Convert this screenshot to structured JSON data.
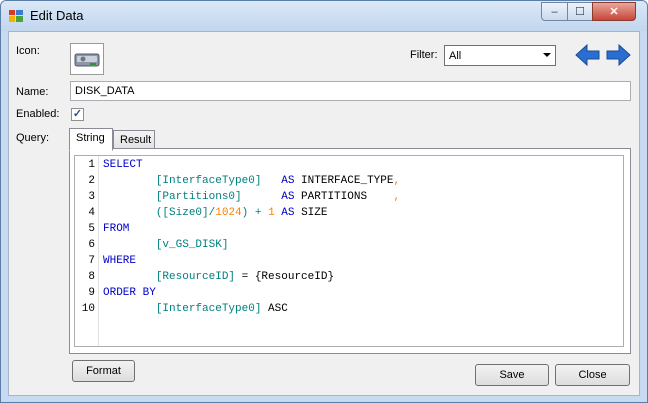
{
  "window": {
    "title": "Edit Data"
  },
  "title_controls": {
    "minimize": "‒",
    "maximize": "☐",
    "close": "✕"
  },
  "labels": {
    "icon": "Icon:",
    "filter": "Filter:",
    "name": "Name:",
    "enabled": "Enabled:",
    "query": "Query:"
  },
  "filter": {
    "selected": "All"
  },
  "name_field": {
    "value": "DISK_DATA"
  },
  "enabled": {
    "checked": true,
    "mark": "✓"
  },
  "tabs": [
    {
      "label": "String",
      "active": true
    },
    {
      "label": "Result",
      "active": false
    }
  ],
  "query_lines": [
    {
      "n": "1",
      "tokens": [
        {
          "t": "SELECT",
          "c": "kw"
        }
      ]
    },
    {
      "n": "2",
      "tokens": [
        {
          "t": "        ",
          "c": "sym"
        },
        {
          "t": "[InterfaceType0]",
          "c": "id"
        },
        {
          "t": "   ",
          "c": "sym"
        },
        {
          "t": "AS",
          "c": "kw"
        },
        {
          "t": " INTERFACE_TYPE",
          "c": "sym"
        },
        {
          "t": ",",
          "c": "cmm"
        }
      ]
    },
    {
      "n": "3",
      "tokens": [
        {
          "t": "        ",
          "c": "sym"
        },
        {
          "t": "[Partitions0]",
          "c": "id"
        },
        {
          "t": "      ",
          "c": "sym"
        },
        {
          "t": "AS",
          "c": "kw"
        },
        {
          "t": " PARTITIONS    ",
          "c": "sym"
        },
        {
          "t": ",",
          "c": "cmm"
        }
      ]
    },
    {
      "n": "4",
      "tokens": [
        {
          "t": "        ",
          "c": "sym"
        },
        {
          "t": "(",
          "c": "id"
        },
        {
          "t": "[Size0]",
          "c": "id"
        },
        {
          "t": "/",
          "c": "id"
        },
        {
          "t": "1024",
          "c": "num"
        },
        {
          "t": ") + ",
          "c": "id"
        },
        {
          "t": "1",
          "c": "num"
        },
        {
          "t": " ",
          "c": "sym"
        },
        {
          "t": "AS",
          "c": "kw"
        },
        {
          "t": " SIZE",
          "c": "sym"
        }
      ]
    },
    {
      "n": "5",
      "tokens": [
        {
          "t": "FROM",
          "c": "kw"
        }
      ]
    },
    {
      "n": "6",
      "tokens": [
        {
          "t": "        ",
          "c": "sym"
        },
        {
          "t": "[v_GS_DISK]",
          "c": "id"
        }
      ]
    },
    {
      "n": "7",
      "tokens": [
        {
          "t": "WHERE",
          "c": "kw"
        }
      ]
    },
    {
      "n": "8",
      "tokens": [
        {
          "t": "        ",
          "c": "sym"
        },
        {
          "t": "[ResourceID]",
          "c": "id"
        },
        {
          "t": " = {ResourceID}",
          "c": "sym"
        }
      ]
    },
    {
      "n": "9",
      "tokens": [
        {
          "t": "ORDER BY",
          "c": "kw"
        }
      ]
    },
    {
      "n": "10",
      "tokens": [
        {
          "t": "        ",
          "c": "sym"
        },
        {
          "t": "[InterfaceType0]",
          "c": "id"
        },
        {
          "t": " ASC",
          "c": "sym"
        }
      ]
    }
  ],
  "buttons": {
    "format": "Format",
    "save": "Save",
    "close": "Close"
  },
  "colors": {
    "keyword": "#0000cc",
    "identifier": "#008080",
    "number": "#ff8000",
    "arrow": "#2a6fd0"
  },
  "icons": {
    "app": "edit-data-app-icon",
    "disk": "hard-disk-icon",
    "back": "arrow-left-icon",
    "forward": "arrow-right-icon"
  }
}
